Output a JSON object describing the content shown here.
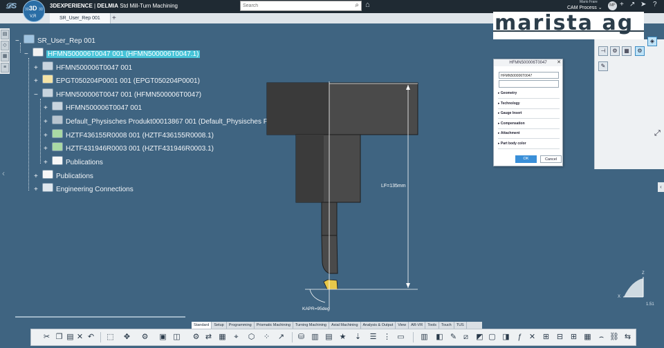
{
  "topbar": {
    "compass_badge": "3D",
    "compass_version": "V,R",
    "compass_left": "3D",
    "compass_right": "3D",
    "brand": "3DEXPERIENCE",
    "product": "DELMIA",
    "app": "Std Mill-Turn Machining",
    "search_placeholder": "Search",
    "user": "Mario Frare",
    "role": "CAM Process",
    "role_chevron": "⌄",
    "avatar_initials": "MF"
  },
  "tabs": {
    "document": "SR_User_Rep 001",
    "new_tab": "+"
  },
  "tree": {
    "root": "SR_User_Rep 001",
    "nodes": [
      {
        "label": "HFMN500006T0047 001 (HFMN500006T0047.1)",
        "selected": true,
        "expander": "−"
      },
      {
        "label": "HFMN500006T0047 001",
        "expander": "+"
      },
      {
        "label": "EPGT050204P0001 001 (EPGT050204P0001)",
        "expander": "+"
      },
      {
        "label": "HFMN500006T0047 001 (HFMN500006T0047)",
        "expander": "−"
      },
      {
        "label": "HFMN500006T0047 001",
        "expander": "+"
      },
      {
        "label": "Default_Physisches Produkt00013867 001 (Default_Physisches P",
        "expander": "+"
      },
      {
        "label": "HZTF436155R0008 001 (HZTF436155R0008.1)",
        "expander": "+"
      },
      {
        "label": "HZTF431946R0003 001 (HZTF431946R0003.1)",
        "expander": "+"
      },
      {
        "label": "Publications",
        "expander": "+"
      },
      {
        "label": "Publications",
        "expander": "+"
      },
      {
        "label": "Engineering Connections",
        "expander": "+"
      }
    ]
  },
  "viewport": {
    "dimension_lf": "LF=135mm",
    "dimension_kapr": "KAPR=95deg",
    "tool_colors": {
      "body": "#4a4a4a",
      "outline": "#1c1c1c",
      "insert": "#e8c84a"
    }
  },
  "dialog": {
    "title": "HFMN500006T0047",
    "close": "✕",
    "name_value": "HFMN500006T0047",
    "sections": [
      "Geometry",
      "Technology",
      "Gauge Insert",
      "Compensation",
      "Attachment",
      "Part body color"
    ],
    "ok": "OK",
    "cancel": "Cancel"
  },
  "watermark": "marista ag",
  "compass": {
    "x": "X",
    "z": "Z",
    "zoom": "1.51"
  },
  "sections_bar": [
    "Standard",
    "Setup",
    "Programming",
    "Prismatic Machining",
    "Turning Machining",
    "Axial Machining",
    "Analysis & Output",
    "View",
    "AR-VR",
    "Tools",
    "Touch",
    "TUS"
  ],
  "active_section": "Standard",
  "icons": {
    "search": "search-icon",
    "tag": "tag-icon",
    "share": "share-icon",
    "collaborate": "collaborate-icon",
    "help": "help-icon"
  }
}
